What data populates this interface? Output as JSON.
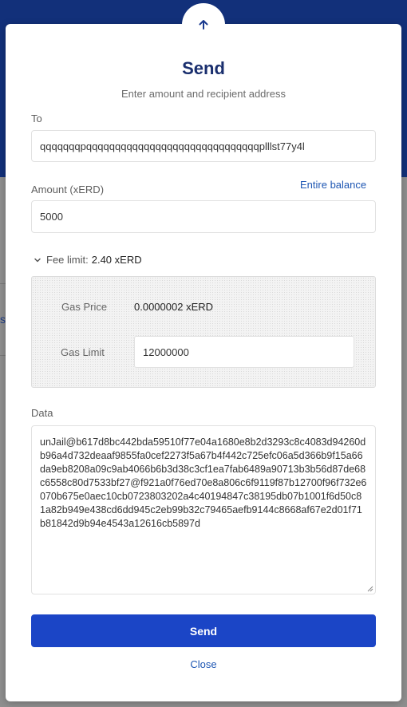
{
  "modal": {
    "title": "Send",
    "subtitle": "Enter amount and recipient address"
  },
  "to": {
    "label": "To",
    "value": "qqqqqqqpqqqqqqqqqqqqqqqqqqqqqqqqqqqqqqplllst77y4l"
  },
  "amount": {
    "label": "Amount (xERD)",
    "entire_balance": "Entire balance",
    "value": "5000"
  },
  "fee": {
    "label": "Fee limit:",
    "amount": "2.40 xERD"
  },
  "gas": {
    "price_label": "Gas Price",
    "price_value": "0.0000002 xERD",
    "limit_label": "Gas Limit",
    "limit_value": "12000000"
  },
  "data": {
    "label": "Data",
    "value": "unJail@b617d8bc442bda59510f77e04a1680e8b2d3293c8c4083d94260db96a4d732deaaf9855fa0cef2273f5a67b4f442c725efc06a5d366b9f15a66da9eb8208a09c9ab4066b6b3d38c3cf1ea7fab6489a90713b3b56d87de68c6558c80d7533bf27@f921a0f76ed70e8a806c6f9119f87b12700f96f732e6070b675e0aec10cb0723803202a4c40194847c38195db07b1001f6d50c81a82b949e438cd6dd945c2eb99b32c79465aefb9144c8668af67e2d01f71b81842d9b94e4543a12616cb5897d"
  },
  "actions": {
    "send": "Send",
    "close": "Close"
  },
  "background": {
    "peek_char": "s"
  },
  "colors": {
    "header_bg": "#12307a",
    "primary": "#1b45c6",
    "link": "#1d56b3",
    "title": "#1a2f6e"
  },
  "icons": {
    "header": "arrow-up-icon",
    "fee_toggle": "chevron-down-icon"
  }
}
